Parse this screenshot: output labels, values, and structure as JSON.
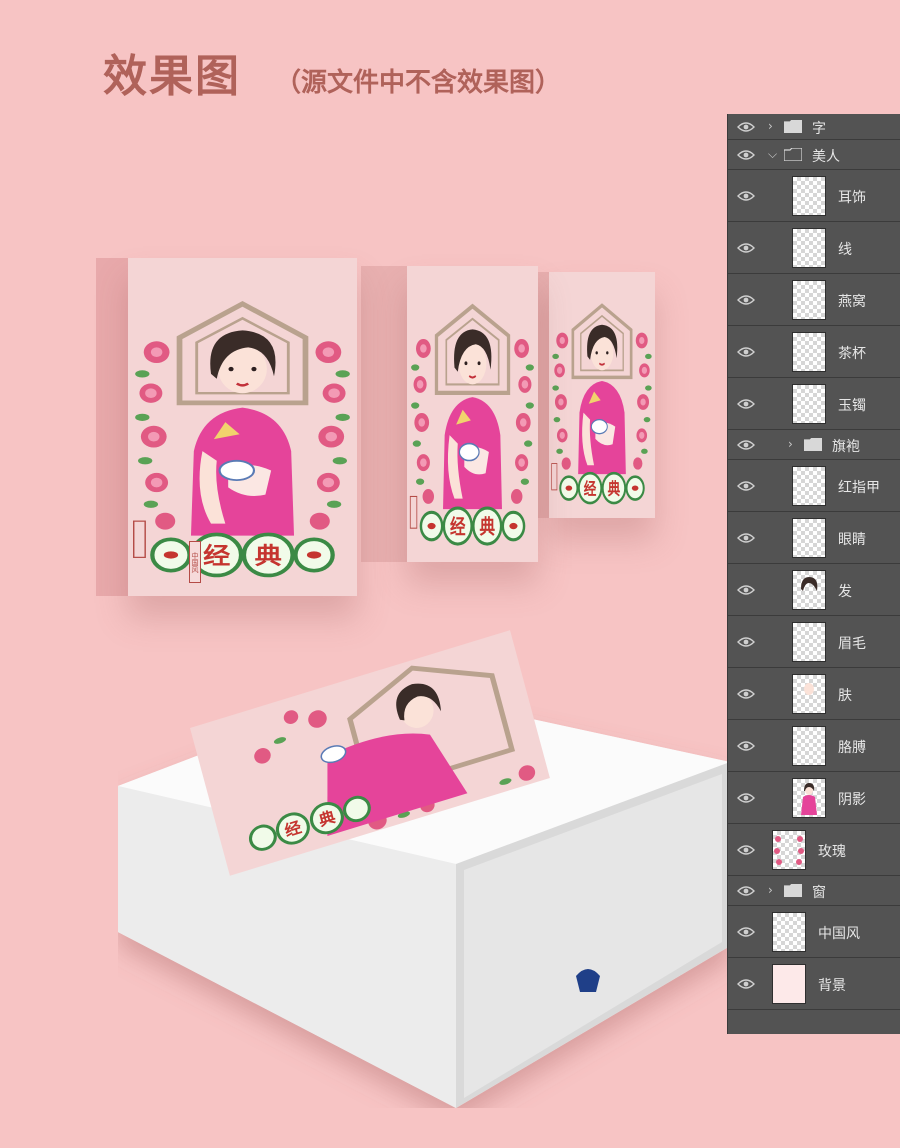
{
  "header": {
    "title": "效果图",
    "note": "（源文件中不含效果图）"
  },
  "packaging": {
    "badge_left": "经",
    "badge_right": "典",
    "stamp": "中国风"
  },
  "layers_panel": {
    "layers": [
      {
        "name": "字",
        "kind": "group",
        "expanded": false,
        "indent": 0
      },
      {
        "name": "美人",
        "kind": "group",
        "expanded": true,
        "indent": 0
      },
      {
        "name": "耳饰",
        "kind": "layer",
        "indent": 1
      },
      {
        "name": "线",
        "kind": "layer",
        "indent": 1
      },
      {
        "name": "燕窝",
        "kind": "layer",
        "indent": 1
      },
      {
        "name": "茶杯",
        "kind": "layer",
        "indent": 1
      },
      {
        "name": "玉镯",
        "kind": "layer",
        "indent": 1
      },
      {
        "name": "旗袍",
        "kind": "group",
        "expanded": false,
        "indent": 1
      },
      {
        "name": "红指甲",
        "kind": "layer",
        "indent": 1
      },
      {
        "name": "眼睛",
        "kind": "layer",
        "indent": 1
      },
      {
        "name": "发",
        "kind": "layer",
        "indent": 1,
        "thumb": "hair"
      },
      {
        "name": "眉毛",
        "kind": "layer",
        "indent": 1
      },
      {
        "name": "肤",
        "kind": "layer",
        "indent": 1,
        "thumb": "skin"
      },
      {
        "name": "胳膊",
        "kind": "layer",
        "indent": 1
      },
      {
        "name": "阴影",
        "kind": "layer",
        "indent": 1,
        "thumb": "lady"
      },
      {
        "name": "玫瑰",
        "kind": "layer",
        "indent": 0,
        "thumb": "roses"
      },
      {
        "name": "窗",
        "kind": "group",
        "expanded": false,
        "indent": 0
      },
      {
        "name": "中国风",
        "kind": "layer",
        "indent": 0
      },
      {
        "name": "背景",
        "kind": "layer",
        "indent": 0,
        "thumb": "bg"
      }
    ]
  }
}
